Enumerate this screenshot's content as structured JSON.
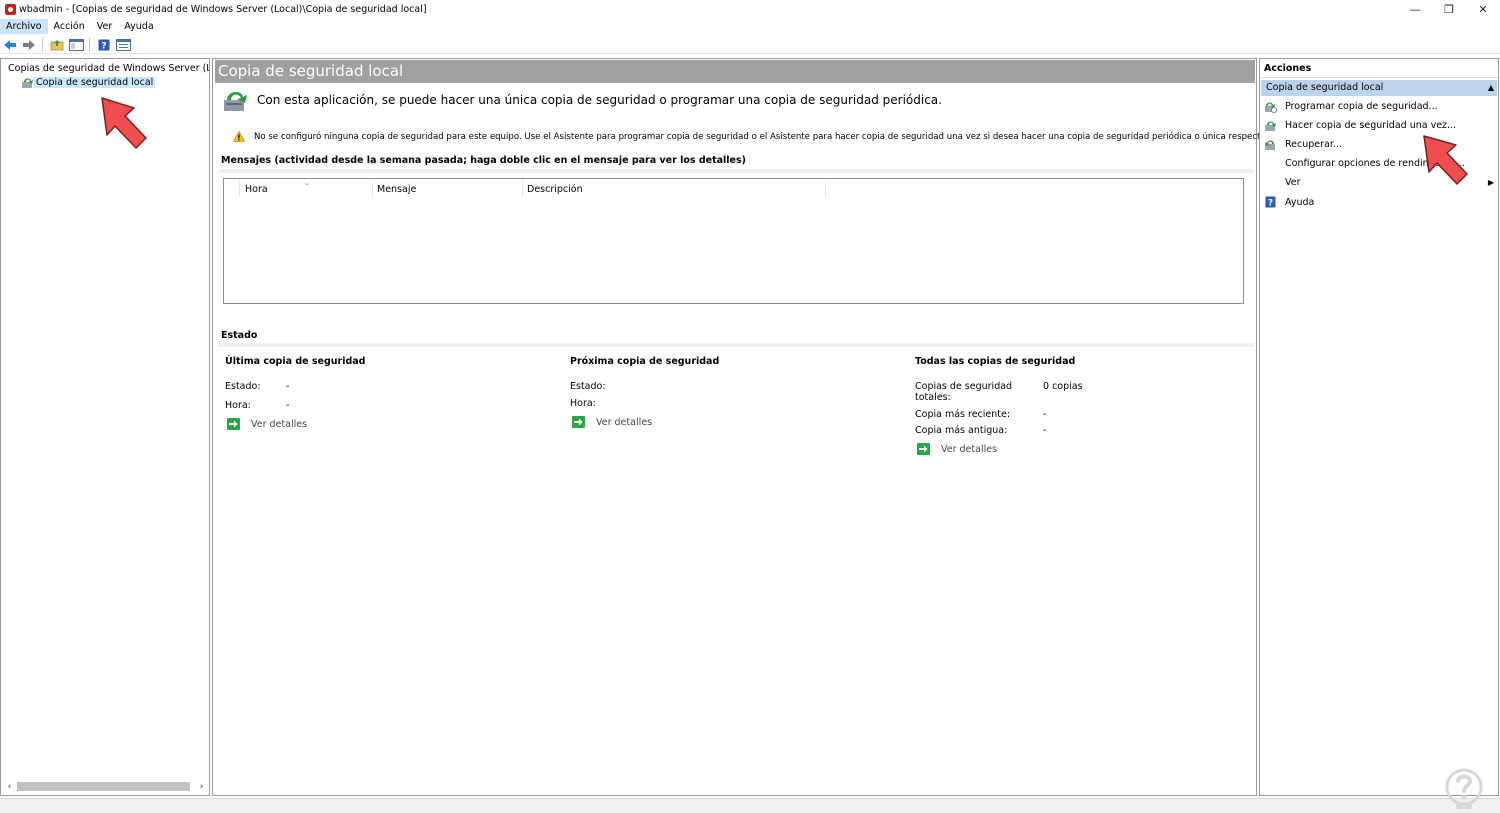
{
  "window": {
    "title": "wbadmin - [Copias de seguridad de Windows Server (Local)\\Copia de seguridad local]",
    "controls": {
      "minimize": "—",
      "restore": "❐",
      "close": "✕"
    }
  },
  "menu": [
    "Archivo",
    "Acción",
    "Ver",
    "Ayuda"
  ],
  "toolbar_icons": [
    "back-icon",
    "forward-icon",
    "up-folder-icon",
    "show-hide-tree-icon",
    "help-icon",
    "properties-icon"
  ],
  "tree": {
    "root_label": "Copias de seguridad de Windows Server (Local)",
    "child_label": "Copia de seguridad local"
  },
  "center": {
    "header": "Copia de seguridad local",
    "intro": "Con esta aplicación, se puede hacer una única copia de seguridad o programar una copia de seguridad periódica.",
    "warning": "No se configuró ninguna copia de seguridad para este equipo. Use el Asistente para programar copia de seguridad o el Asistente para hacer copia de seguridad una vez si desea hacer una copia de seguridad periódica o única respectivamente.",
    "messages_title": "Mensajes (actividad desde la semana pasada; haga doble clic en el mensaje para ver los detalles)",
    "columns": [
      "Hora",
      "Mensaje",
      "Descripción"
    ],
    "status_title": "Estado",
    "last_backup": {
      "title": "Última copia de seguridad",
      "state_label": "Estado:",
      "state_value": "-",
      "time_label": "Hora:",
      "time_value": "-",
      "link": "Ver detalles"
    },
    "next_backup": {
      "title": "Próxima copia de seguridad",
      "state_label": "Estado:",
      "state_value": "",
      "time_label": "Hora:",
      "time_value": "",
      "link": "Ver detalles"
    },
    "all_backups": {
      "title": "Todas las copias de seguridad",
      "total_label": "Copias de seguridad totales:",
      "total_value": "0 copias",
      "recent_label": "Copia más reciente:",
      "recent_value": "-",
      "oldest_label": "Copia más antigua:",
      "oldest_value": "-",
      "link": "Ver detalles"
    }
  },
  "actions": {
    "header": "Acciones",
    "section": "Copia de seguridad local",
    "items": [
      "Programar copia de seguridad...",
      "Hacer copia de seguridad una vez...",
      "Recuperar...",
      "Configurar opciones de rendimiento...",
      "Ver",
      "Ayuda"
    ]
  },
  "colors": {
    "header_gray": "#a0a0a0",
    "selection": "#cce8ff",
    "actions_section": "#bcd3ec",
    "pointer_red": "#ee4e4e",
    "link_green": "#29a745"
  }
}
